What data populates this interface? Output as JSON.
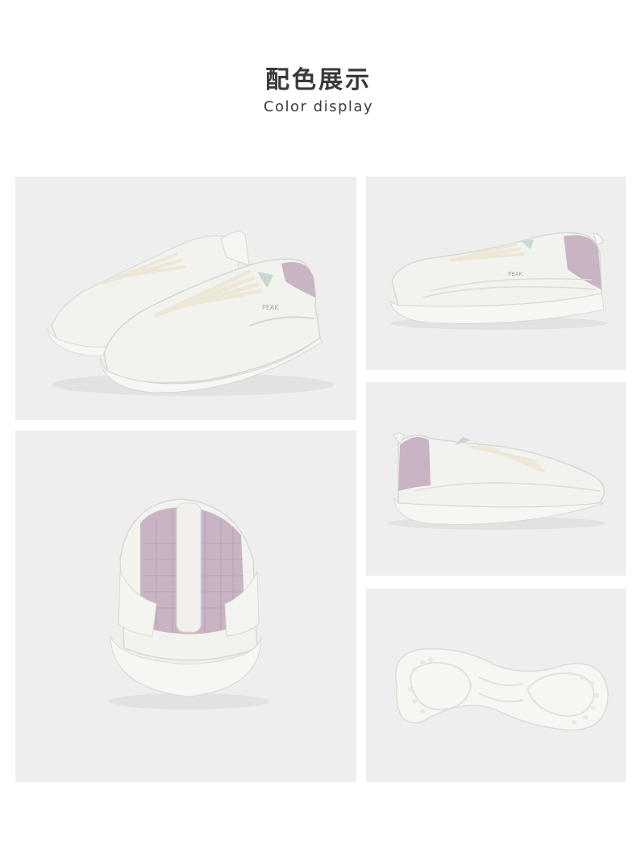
{
  "header": {
    "title_zh": "配色展示",
    "title_en": "Color display"
  },
  "colors": {
    "panel_bg": "#eeeeef",
    "upper_white": "#f2f2ef",
    "sole_white": "#f7f6f2",
    "mesh_lilac": "#c9b4c4",
    "accent_mint": "#c8d6d4",
    "laces": "#ede7d6"
  },
  "product": {
    "brand_mark": "PEAK"
  }
}
